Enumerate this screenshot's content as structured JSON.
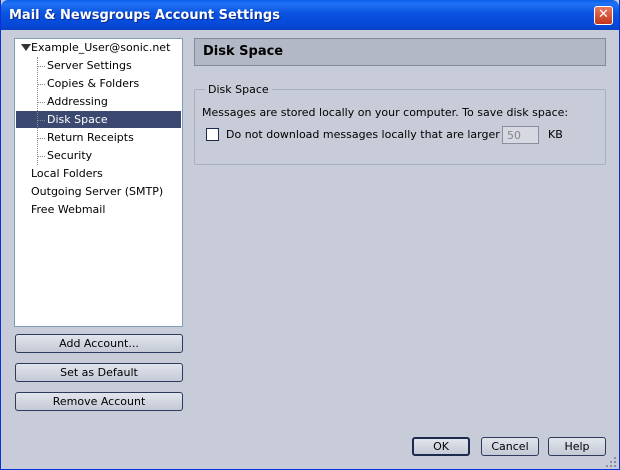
{
  "window": {
    "title": "Mail & Newsgroups Account Settings",
    "close_label": "✕"
  },
  "tree": {
    "account": "Example_User@sonic.net",
    "children": [
      {
        "label": "Server Settings"
      },
      {
        "label": "Copies & Folders"
      },
      {
        "label": "Addressing"
      },
      {
        "label": "Disk Space",
        "selected": true
      },
      {
        "label": "Return Receipts"
      },
      {
        "label": "Security"
      }
    ],
    "top_level": [
      {
        "label": "Local Folders"
      },
      {
        "label": "Outgoing Server (SMTP)"
      },
      {
        "label": "Free Webmail"
      }
    ]
  },
  "sidebar_buttons": {
    "add_account": "Add Account...",
    "set_default": "Set as Default",
    "remove_account": "Remove Account"
  },
  "panel": {
    "header": "Disk Space",
    "group_title": "Disk Space",
    "description": "Messages are stored locally on your computer. To save disk space:",
    "checkbox_label": "Do not download messages locally that are larger than",
    "checkbox_checked": false,
    "size_value": "50",
    "size_unit": "KB"
  },
  "dialog_buttons": {
    "ok": "OK",
    "cancel": "Cancel",
    "help": "Help"
  }
}
